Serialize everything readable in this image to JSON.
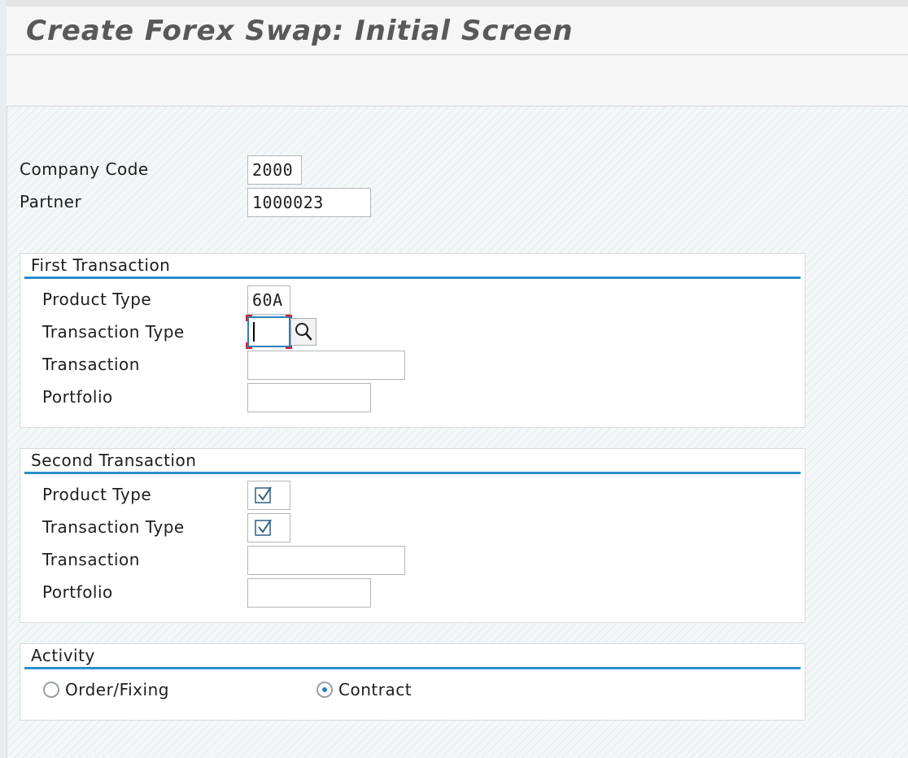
{
  "window": {
    "title": "Create Forex Swap: Initial Screen"
  },
  "header_fields": {
    "company_code": {
      "label": "Company Code",
      "value": "2000"
    },
    "partner": {
      "label": "Partner",
      "value": "1000023"
    }
  },
  "first_transaction": {
    "title": "First Transaction",
    "product_type": {
      "label": "Product Type",
      "value": "60A"
    },
    "transaction_type": {
      "label": "Transaction Type",
      "value": ""
    },
    "transaction": {
      "label": "Transaction",
      "value": ""
    },
    "portfolio": {
      "label": "Portfolio",
      "value": ""
    }
  },
  "second_transaction": {
    "title": "Second Transaction",
    "product_type": {
      "label": "Product Type",
      "checked": true
    },
    "transaction_type": {
      "label": "Transaction Type",
      "checked": true
    },
    "transaction": {
      "label": "Transaction",
      "value": ""
    },
    "portfolio": {
      "label": "Portfolio",
      "value": ""
    }
  },
  "activity": {
    "title": "Activity",
    "options": [
      {
        "label": "Order/Fixing",
        "selected": false
      },
      {
        "label": "Contract",
        "selected": true
      }
    ]
  },
  "icons": {
    "value_help": "search-icon",
    "checkbox_mark": "checkmark-icon"
  },
  "colors": {
    "accent": "#2a8fca",
    "required_marker": "#d0202a",
    "focus_border": "#2f7fb8"
  }
}
